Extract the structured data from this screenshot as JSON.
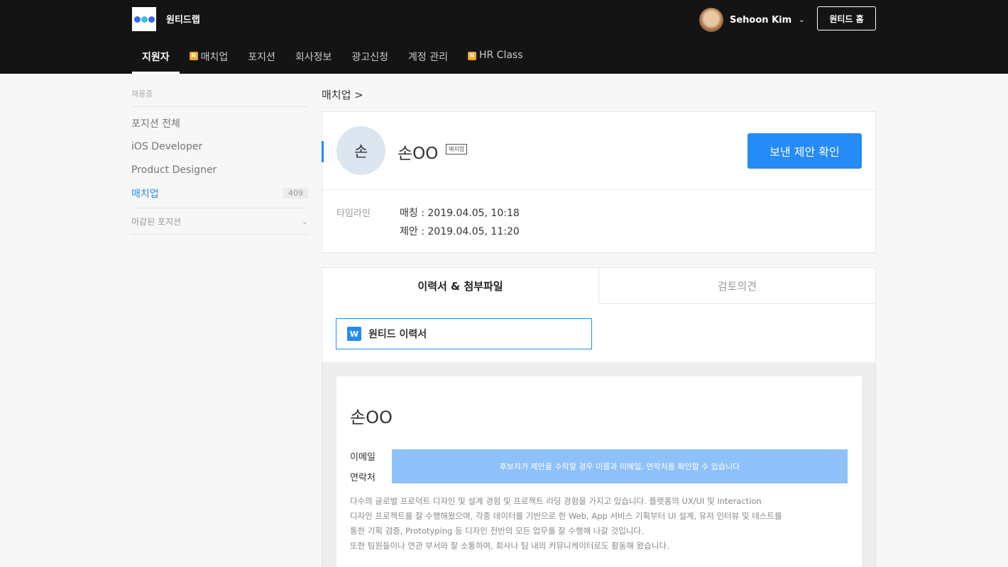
{
  "header": {
    "brand": "원티드랩",
    "logo_colors": [
      "#3a66f0",
      "#31c2d9",
      "#3a66f0"
    ],
    "user_name": "Sehoon Kim",
    "home_button": "원티드 홈",
    "nav": [
      {
        "label": "지원자",
        "badge": ""
      },
      {
        "label": "매치업",
        "badge": "N"
      },
      {
        "label": "포지션",
        "badge": ""
      },
      {
        "label": "회사정보",
        "badge": ""
      },
      {
        "label": "광고신청",
        "badge": ""
      },
      {
        "label": "계정 관리",
        "badge": ""
      },
      {
        "label": "HR Class",
        "badge": "N"
      }
    ]
  },
  "sidebar": {
    "section_title": "채용중",
    "items": [
      {
        "label": "포지션 전체",
        "count": ""
      },
      {
        "label": "iOS Developer",
        "count": ""
      },
      {
        "label": "Product Designer",
        "count": ""
      },
      {
        "label": "매치업",
        "count": "409"
      }
    ],
    "closed_positions": "마감된 포지션"
  },
  "main": {
    "breadcrumb": "매치업 >",
    "candidate": {
      "avatar_char": "손",
      "name": "손OO",
      "badge": "매치업",
      "confirm_button": "보낸 제안 확인"
    },
    "timeline": {
      "label": "타임라인",
      "rows": [
        "매칭 : 2019.04.05, 10:18",
        "제안 : 2019.04.05, 11:20"
      ]
    },
    "tabs": [
      "이력서 & 첨부파일",
      "검토의견"
    ],
    "file": {
      "icon_letter": "W",
      "label": "원티드 이력서"
    },
    "resume": {
      "name": "손OO",
      "email_label": "이메일",
      "phone_label": "연락처",
      "hidden_notice": "후보자가 제안을 수락할 경우 이름과 이메일, 연락처를 확인할 수 있습니다",
      "summary_lines": [
        "다수의 글로벌 프로덕트 디자인 및 설계 경험 및 프로젝트 리딩 경험을 가지고 있습니다. 플랫폼의 UX/UI 및 Interaction",
        "디자인 프로젝트를 잘 수행해왔으며, 각종 데이터를 기반으로 한 Web, App 서비스 기획부터 UI 설계, 유저 인터뷰 및 테스트를",
        "통한 기획 검증, Prototyping 등 디자인 전반의 모든 업무를 잘 수행해 나갈 것입니다.",
        "또한 팀원들이나 연관 부서와 잘 소통하여, 회사나 팀 내의 커뮤니케이터로도 활동해 왔습니다."
      ]
    }
  }
}
